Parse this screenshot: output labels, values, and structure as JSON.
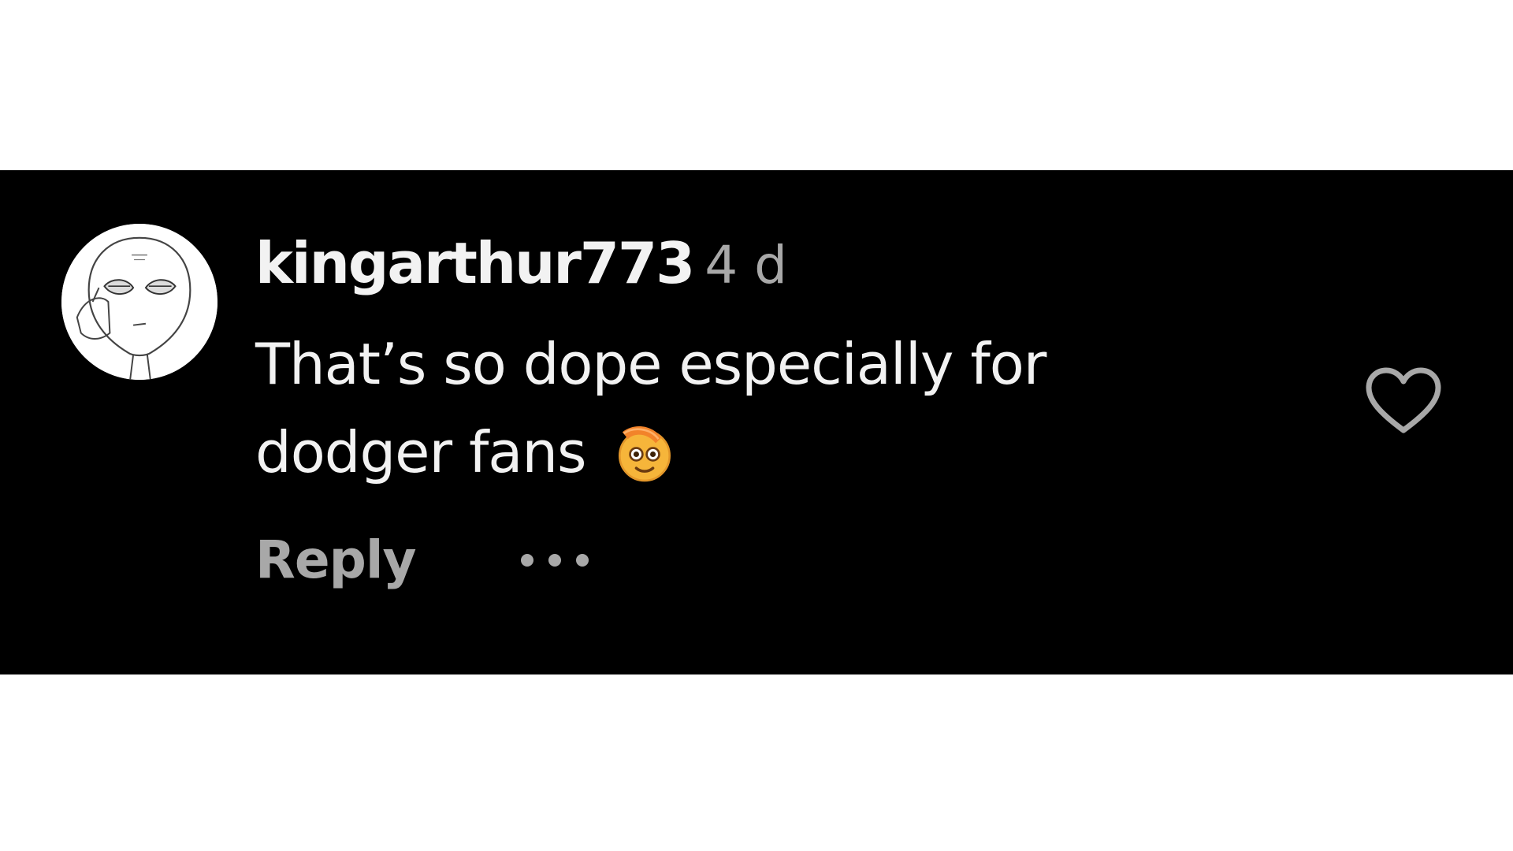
{
  "comment": {
    "username": "kingarthur773",
    "timestamp": "4 d",
    "text": "That’s so dope especially for dodger fans",
    "emoji": "face-with-bandage-on-head"
  },
  "actions": {
    "reply_label": "Reply",
    "more_icon": "ellipsis-icon",
    "like_icon": "heart-outline-icon"
  },
  "colors": {
    "background": "#000000",
    "primary_text": "#f2f2f2",
    "secondary_text": "#a8a8a8",
    "page_background": "#ffffff"
  }
}
